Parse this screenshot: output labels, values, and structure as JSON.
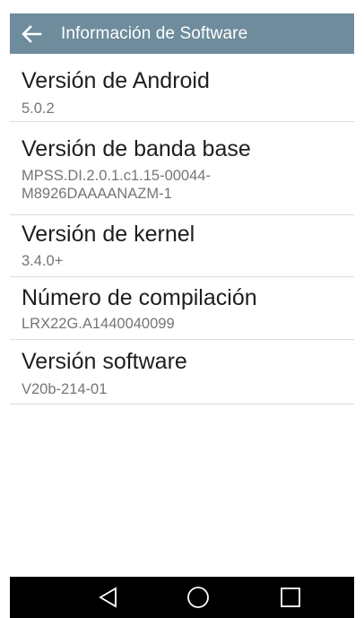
{
  "header": {
    "title": "Información de Software",
    "back_icon": "arrow-left-icon"
  },
  "items": [
    {
      "title": "Versión de Android",
      "value": "5.0.2"
    },
    {
      "title": "Versión de banda base",
      "value": "MPSS.DI.2.0.1.c1.15-00044-\nM8926DAAAANAZM-1"
    },
    {
      "title": "Versión de kernel",
      "value": "3.4.0+"
    },
    {
      "title": "Número de compilación",
      "value": "LRX22G.A1440040099"
    },
    {
      "title": "Versión software",
      "value": "V20b-214-01"
    }
  ],
  "navigation": {
    "back_icon": "triangle-back-icon",
    "home_icon": "circle-home-icon",
    "recent_icon": "square-recent-apps-icon"
  },
  "colors": {
    "app_bar": "#6e8c9c",
    "title_text": "#1e1e1e",
    "value_text": "#757575",
    "divider": "#dcdcdc",
    "nav_bar": "#000000"
  }
}
